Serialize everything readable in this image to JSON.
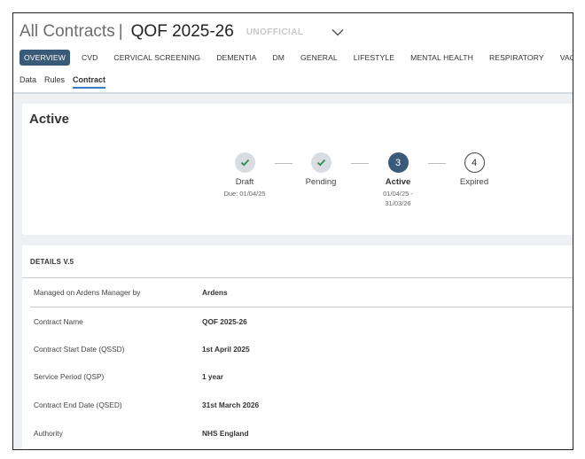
{
  "header": {
    "breadcrumb_root": "All Contracts",
    "separator": "|",
    "title": "QOF 2025-26",
    "badge": "UNOFFICIAL"
  },
  "nav_tabs": [
    {
      "label": "OVERVIEW",
      "active": true
    },
    {
      "label": "CVD"
    },
    {
      "label": "CERVICAL SCREENING"
    },
    {
      "label": "DEMENTIA"
    },
    {
      "label": "DM"
    },
    {
      "label": "GENERAL"
    },
    {
      "label": "LIFESTYLE"
    },
    {
      "label": "MENTAL HEALTH"
    },
    {
      "label": "RESPIRATORY"
    },
    {
      "label": "VACCINATIONS"
    }
  ],
  "sub_tabs": [
    {
      "label": "Data"
    },
    {
      "label": "Rules"
    },
    {
      "label": "Contract",
      "active": true
    }
  ],
  "status_card": {
    "title": "Active",
    "steps": [
      {
        "label": "Draft",
        "sub": "Due: 01/04/25",
        "state": "done",
        "icon": "check-icon"
      },
      {
        "label": "Pending",
        "sub": "",
        "state": "done",
        "icon": "check-icon"
      },
      {
        "label": "Active",
        "number": "3",
        "sub_line1": "01/04/25 -",
        "sub_line2": "31/03/26",
        "state": "current"
      },
      {
        "label": "Expired",
        "number": "4",
        "state": "future"
      }
    ]
  },
  "details": {
    "title": "DETAILS V.5",
    "rows": [
      {
        "label": "Managed on Ardens Manager by",
        "value": "Ardens"
      },
      {
        "label": "Contract Name",
        "value": "QOF 2025-26"
      },
      {
        "label": "Contract Start Date (QSSD)",
        "value": "1st April 2025"
      },
      {
        "label": "Service Period (QSP)",
        "value": "1 year"
      },
      {
        "label": "Contract End Date (QSED)",
        "value": "31st March 2026"
      },
      {
        "label": "Authority",
        "value": "NHS England"
      }
    ]
  },
  "colors": {
    "accent_dark": "#3a5a7a",
    "accent_link": "#3a7bbf",
    "check_green": "#2e8b57",
    "page_bg": "#eef0f3"
  }
}
